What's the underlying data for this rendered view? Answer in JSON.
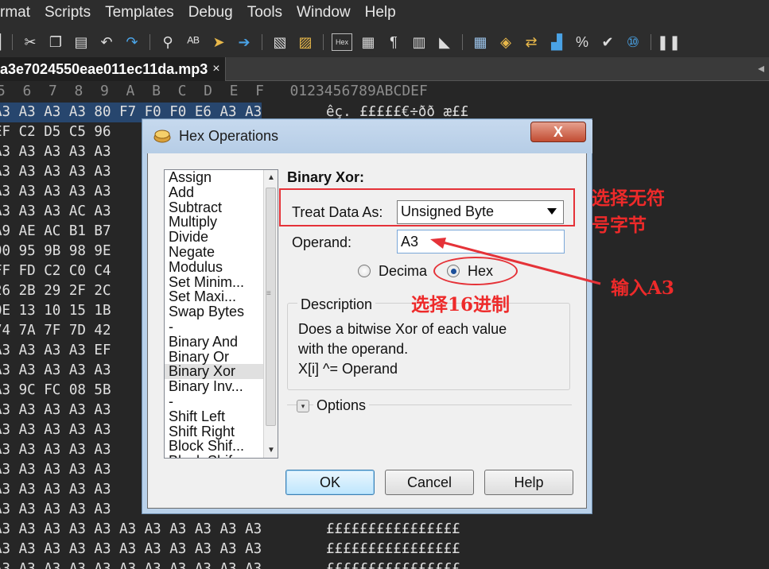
{
  "menubar": {
    "items": [
      "rmat",
      "Scripts",
      "Templates",
      "Debug",
      "Tools",
      "Window",
      "Help"
    ]
  },
  "toolbar": {
    "icons": [
      "partial-icon",
      "scissors-icon",
      "copy-icon",
      "paste-icon",
      "undo-icon",
      "redo-icon",
      "find-icon",
      "find-replace-icon",
      "goto-icon",
      "jump-arrow-icon",
      "bookmark-icon",
      "bookmark-list-icon",
      "hex-mode-icon",
      "columns-icon",
      "paragraph-icon",
      "split-icon",
      "eraser-icon",
      "calculator-icon",
      "compare-icon",
      "swap-icon",
      "histogram-icon",
      "percent-icon",
      "checksum-icon",
      "base-convert-icon",
      "pause-icon"
    ],
    "hex_label": "Hex"
  },
  "tab": {
    "filename": "a3e7024550eae011ec11da.mp3",
    "close": "×",
    "scroll_left": "◂"
  },
  "hex": {
    "header": "5  6  7  8  9  A  B  C  D  E  F   0123456789ABCDEF",
    "rows": [
      {
        "bytes": "A3 A3 A3 A3 80 F7 F0 F0 E6 A3 A3",
        "ascii": "êç. £££££€÷ðð æ££",
        "selected": true
      },
      {
        "bytes": "EF C2 D5 C5 96",
        "ascii": "",
        "selected": false
      },
      {
        "bytes": "A3 A3 A3 A3 A3",
        "ascii": "",
        "selected": false
      },
      {
        "bytes": "A3 A3 A3 A3 A3",
        "ascii": "",
        "selected": false
      },
      {
        "bytes": "A3 A3 A3 A3 A3",
        "ascii": "",
        "selected": false
      },
      {
        "bytes": "A3 A3 A3 AC A3",
        "ascii": "",
        "selected": false
      },
      {
        "bytes": "A9 AE AC B1 B7",
        "ascii": "",
        "selected": false
      },
      {
        "bytes": "90 95 9B 98 9E",
        "ascii": "",
        "selected": false
      },
      {
        "bytes": "FF FD C2 C0 C4",
        "ascii": "",
        "selected": false
      },
      {
        "bytes": "26 2B 29 2F 2C",
        "ascii": "",
        "selected": false
      },
      {
        "bytes": "0E 13 10 15 1B",
        "ascii": "",
        "selected": false
      },
      {
        "bytes": "74 7A 7F 7D 42",
        "ascii": "",
        "selected": false
      },
      {
        "bytes": "A3 A3 A3 A3 EF",
        "ascii": "",
        "selected": false
      },
      {
        "bytes": "A3 A3 A3 A3 A3",
        "ascii": "",
        "selected": false
      },
      {
        "bytes": "A3 9C FC 08 5B",
        "ascii": "",
        "selected": false
      },
      {
        "bytes": "A3 A3 A3 A3 A3",
        "ascii": "",
        "selected": false
      },
      {
        "bytes": "A3 A3 A3 A3 A3",
        "ascii": "",
        "selected": false
      },
      {
        "bytes": "A3 A3 A3 A3 A3",
        "ascii": "",
        "selected": false
      },
      {
        "bytes": "A3 A3 A3 A3 A3",
        "ascii": "",
        "selected": false
      },
      {
        "bytes": "A3 A3 A3 A3 A3",
        "ascii": "",
        "selected": false
      },
      {
        "bytes": "A3 A3 A3 A3 A3",
        "ascii": "",
        "selected": false
      },
      {
        "bytes": "A3 A3 A3 A3 A3 A3 A3 A3 A3 A3 A3",
        "ascii": "££££££££££££££££",
        "selected": false
      },
      {
        "bytes": "A3 A3 A3 A3 A3 A3 A3 A3 A3 A3 A3",
        "ascii": "££££££££££££££££",
        "selected": false
      },
      {
        "bytes": "A3 A3 A3 A3 A3 A3 A3 A3 A3 A3 A3",
        "ascii": "££££££££££££££££",
        "selected": false
      }
    ]
  },
  "dialog": {
    "title": "Hex Operations",
    "close": "X",
    "operations": [
      "Assign",
      "Add",
      "Subtract",
      "Multiply",
      "Divide",
      "Negate",
      "Modulus",
      "Set Minim...",
      "Set Maxi...",
      "Swap Bytes",
      "-",
      "Binary And",
      "Binary Or",
      "Binary Xor",
      "Binary Inv...",
      "-",
      "Shift Left",
      "Shift Right",
      "Block Shif...",
      "Block Shif"
    ],
    "selected_operation": "Binary Xor",
    "section_title": "Binary Xor:",
    "treat_label": "Treat Data As:",
    "treat_value": "Unsigned Byte",
    "operand_label": "Operand:",
    "operand_value": "A3",
    "radio_decimal": "Decima",
    "radio_hex": "Hex",
    "radio_selected": "hex",
    "description_title": "Description",
    "description_lines": [
      "Does a bitwise Xor of each value",
      "with the operand.",
      "X[i] ^= Operand"
    ],
    "options_label": "Options",
    "options_toggle": "▾",
    "ok": "OK",
    "cancel": "Cancel",
    "help": "Help"
  },
  "annotations": {
    "treat_note_line1": "选择无符",
    "treat_note_line2": "号字节",
    "operand_note": "输入A3",
    "hex_note": "选择16进制",
    "color": "#e53238"
  }
}
